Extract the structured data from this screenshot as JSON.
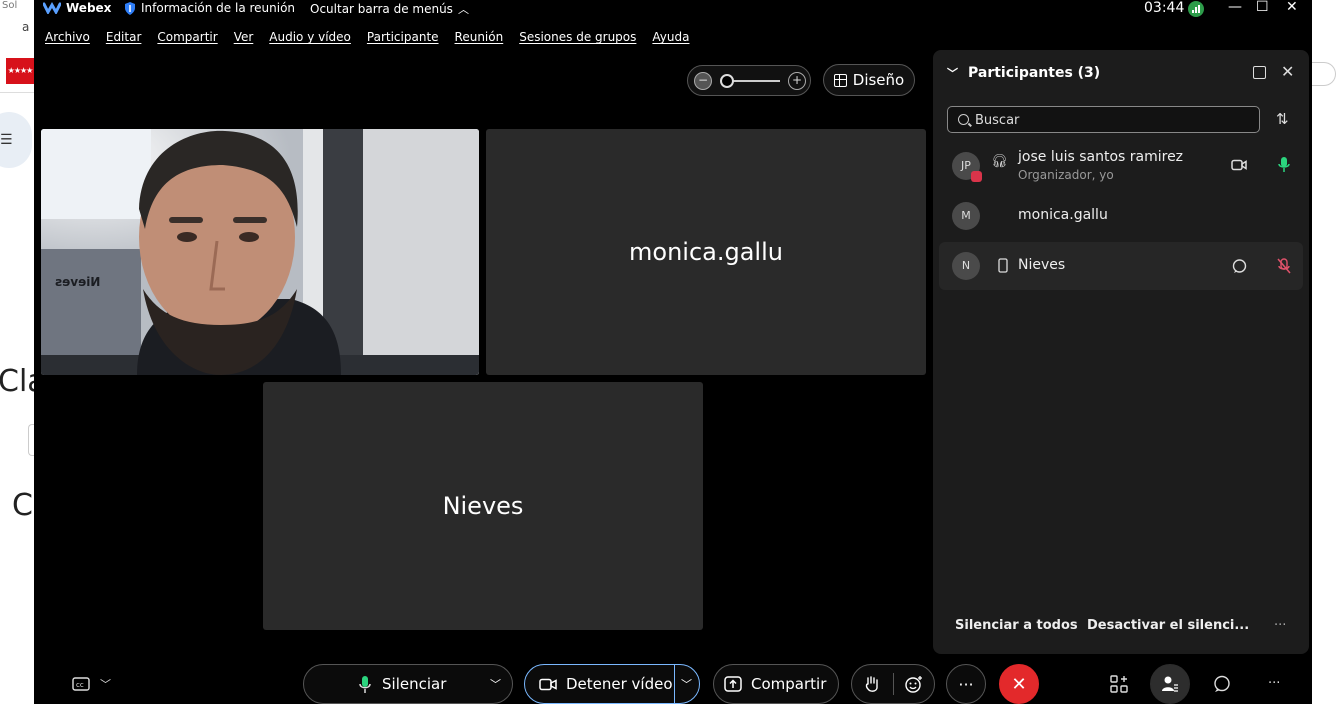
{
  "background": {
    "tab_fragment": "Sol",
    "address_fragment": "a",
    "flag_text": "★★★★",
    "heading_fragment_1": "Cla",
    "heading_fragment_2": "C"
  },
  "titlebar": {
    "app_name": "Webex",
    "meeting_info": "Información de la reunión",
    "hide_menu": "Ocultar barra de menús",
    "clock": "03:44",
    "minimize": "—",
    "maximize": "☐",
    "close": "✕"
  },
  "menu": [
    "Archivo",
    "Editar",
    "Compartir",
    "Ver",
    "Audio y vídeo",
    "Participante",
    "Reunión",
    "Sesiones de grupos",
    "Ayuda"
  ],
  "layout_button": "Diseño",
  "zoom": {
    "out": "−",
    "in": "+",
    "level": 0.1
  },
  "tiles": {
    "video_caption": "Nieves",
    "monica": "monica.gallu",
    "nieves": "Nieves"
  },
  "panel": {
    "title": "Participantes (3)",
    "search_placeholder": "Buscar",
    "participants": [
      {
        "initials": "JP",
        "name": "jose luis santos ramirez",
        "role": "Organizador, yo"
      },
      {
        "initials": "M",
        "name": "monica.gallu",
        "role": ""
      },
      {
        "initials": "N",
        "name": "Nieves",
        "role": ""
      }
    ],
    "mute_all": "Silenciar a todos",
    "unmute_all": "Desactivar el silenci...",
    "more": "···"
  },
  "toolbar": {
    "mute": "Silenciar",
    "stop_video": "Detener vídeo",
    "share": "Compartir",
    "more": "···",
    "more_right": "···"
  },
  "colors": {
    "end_call": "#e3292b",
    "panel_bg": "#1c1c1c",
    "tile_bg": "#2a2a2a",
    "mic": "#2bd47e",
    "muted": "#e0526b"
  }
}
